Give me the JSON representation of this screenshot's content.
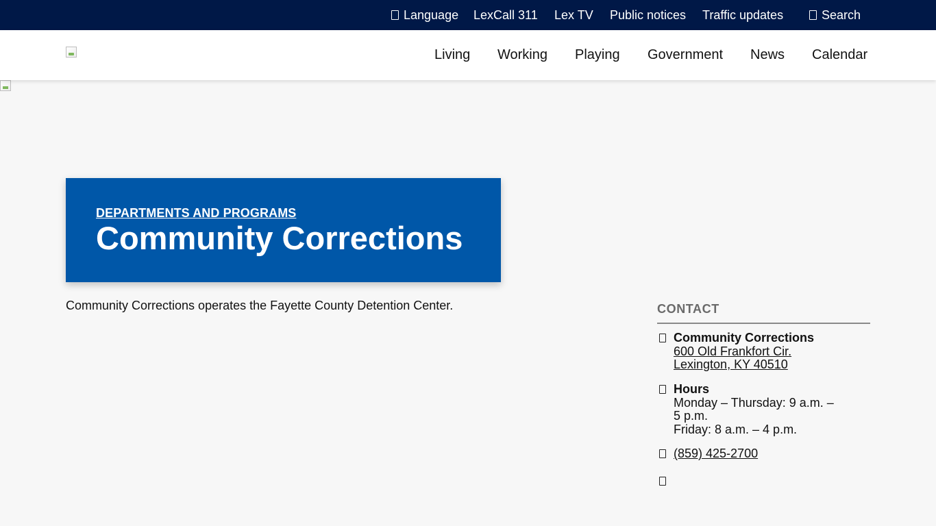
{
  "utility_bar": {
    "language": "Language",
    "lexcall": "LexCall 311",
    "lextv": "Lex TV",
    "public_notices": "Public notices",
    "traffic_updates": "Traffic updates",
    "search": "Search"
  },
  "nav": {
    "items": [
      "Living",
      "Working",
      "Playing",
      "Government",
      "News",
      "Calendar"
    ]
  },
  "banner": {
    "breadcrumb": "DEPARTMENTS AND PROGRAMS",
    "title": "Community Corrections"
  },
  "intro": "Community Corrections operates the Fayette County Detention Center.",
  "contact": {
    "heading": "CONTACT",
    "name": "Community Corrections",
    "address_line1": "600 Old Frankfort Cir.",
    "address_line2": "Lexington, KY 40510",
    "hours_label": "Hours",
    "hours_line1": "Monday – Thursday: 9 a.m. –",
    "hours_line2": "5 p.m.",
    "hours_line3": "Friday: 8 a.m. – 4 p.m.",
    "phone": "(859) 425-2700"
  },
  "colors": {
    "utility_bar_bg": "#001847",
    "banner_bg": "#0057a8",
    "page_bg": "#f7f7f7",
    "contact_heading": "#6a6a6a"
  },
  "icons": {
    "language": "globe-icon",
    "search": "search-icon",
    "address": "map-marker-icon",
    "hours": "clock-icon",
    "phone": "phone-icon",
    "extra": "email-icon"
  }
}
